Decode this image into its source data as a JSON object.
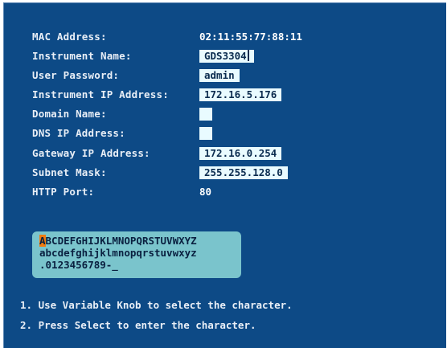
{
  "settings": {
    "mac_label": "MAC Address:",
    "mac_value": "02:11:55:77:88:11",
    "name_label": "Instrument Name:",
    "name_value": "GDS3304",
    "password_label": "User Password:",
    "password_value": "admin",
    "ip_label": "Instrument IP Address:",
    "ip_value": "172.16.5.176",
    "domain_label": "Domain Name:",
    "domain_value": "",
    "dns_label": "DNS IP Address:",
    "dns_value": "",
    "gateway_label": "Gateway IP Address:",
    "gateway_value": "172.16.0.254",
    "subnet_label": "Subnet Mask:",
    "subnet_value": "255.255.128.0",
    "http_label": "HTTP Port:",
    "http_value": "80"
  },
  "keyboard": {
    "selected_char": "A",
    "line1_rest": "BCDEFGHIJKLMNOPQRSTUVWXYZ",
    "line2": "abcdefghijklmnopqrstuvwxyz",
    "line3": ".0123456789-_"
  },
  "instructions": {
    "step1": "1. Use Variable Knob to select the character.",
    "step2": "2. Press Select to enter the character."
  },
  "colors": {
    "background": "#0d4a86",
    "field": "#e9fbff",
    "keyboard": "#7ac4cc",
    "selection": "#f07a10"
  }
}
